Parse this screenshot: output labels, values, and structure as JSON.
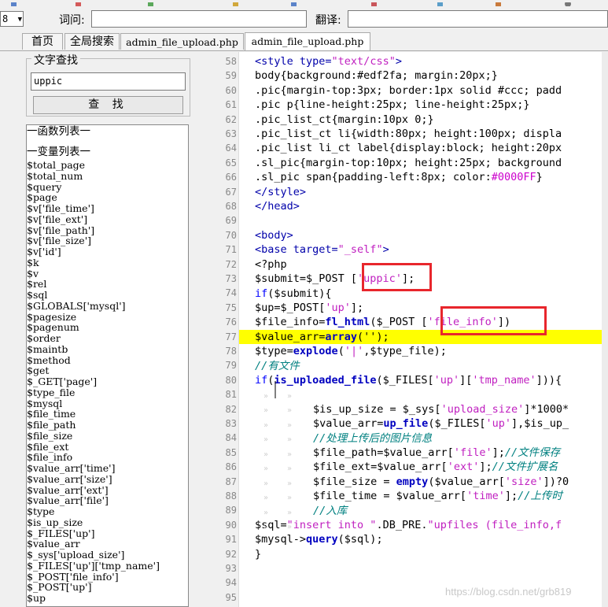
{
  "toolbar": {
    "select_value": "8",
    "word_label": "词问:",
    "translate_label": "翻译:"
  },
  "tabs": [
    {
      "label": "首页"
    },
    {
      "label": "全局搜索"
    },
    {
      "label": "admin_file_upload.php"
    },
    {
      "label": "admin_file_upload.php"
    }
  ],
  "search_panel": {
    "title": "文字查找",
    "input_value": "uppic",
    "find_button": "查 找"
  },
  "list": {
    "function_header": "一函数列表一",
    "variable_header": "一变量列表一",
    "variables": [
      "$total_page",
      "$total_num",
      "$query",
      "$page",
      "$v['file_time']",
      "$v['file_ext']",
      "$v['file_path']",
      "$v['file_size']",
      "$v['id']",
      "$k",
      "$v",
      "$rel",
      "$sql",
      "$GLOBALS['mysql']",
      "$pagesize",
      "$pagenum",
      "$order",
      "$maintb",
      "$method",
      "$get",
      "$_GET['page']",
      "$type_file",
      "$mysql",
      "$file_time",
      "$file_path",
      "$file_size",
      "$file_ext",
      "$file_info",
      "$value_arr['time']",
      "$value_arr['size']",
      "$value_arr['ext']",
      "$value_arr['file']",
      "$type",
      "$is_up_size",
      "$_FILES['up']",
      "$value_arr",
      "$_sys['upload_size']",
      "$_FILES['up']['tmp_name']",
      "$_POST['file_info']",
      "$_POST['up']",
      "$up"
    ]
  },
  "editor": {
    "line_numbers": [
      "58",
      "59",
      "60",
      "61",
      "62",
      "63",
      "64",
      "65",
      "66",
      "67",
      "68",
      "69",
      "70",
      "71",
      "72",
      "73",
      "74",
      "75",
      "76",
      "77",
      "78",
      "79",
      "80",
      "81",
      "82",
      "83",
      "84",
      "85",
      "86",
      "87",
      "88",
      "89",
      "90",
      "91",
      "92",
      "93",
      "94",
      "95"
    ],
    "highlighted_line": "77",
    "code": {
      "l58a": "<style type=",
      "l58b": "\"text/css\"",
      "l58c": ">",
      "l59": "body{background:#edf2fa; margin:20px;}",
      "l60": ".pic{margin-top:3px; border:1px solid #ccc; padd",
      "l61": ".pic p{line-height:25px; line-height:25px;}",
      "l62": ".pic_list_ct{margin:10px 0;}",
      "l63": ".pic_list_ct li{width:80px; height:100px; displa",
      "l64": ".pic_list li_ct label{display:block; height:20px",
      "l65": ".sl_pic{margin-top:10px; height:25px; background",
      "l66a": ".sl_pic span{padding-left:8px; color:",
      "l66b": "#0000FF",
      "l66c": "}",
      "l67": "</style>",
      "l68": "</head>",
      "l69": "",
      "l70": "<body>",
      "l71a": "<base target=",
      "l71b": "\"_self\"",
      "l71c": ">",
      "l72": "<?php",
      "l73a": "$submit=$_POST [",
      "l73b": "'uppic'",
      "l73c": "];",
      "l74a": "if",
      "l74b": "($submit){",
      "l75a": "$up=$_POST[",
      "l75b": "'up'",
      "l75c": "];",
      "l76a": "$file_info=",
      "l76b": "fl_html",
      "l76c": "($_POST [",
      "l76d": "'file_info'",
      "l76e": "])",
      "l77a": "$value_arr=",
      "l77b": "array",
      "l77c": "('');",
      "l78a": "$type=",
      "l78b": "explode",
      "l78c": "(",
      "l78d": "'|'",
      "l78e": ",$type_file);",
      "l79": "//有文件",
      "l80a": "if",
      "l80b": "(",
      "l80c": "is_uploaded_file",
      "l80d": "($_FILES[",
      "l80e": "'up'",
      "l80f": "][",
      "l80g": "'tmp_name'",
      "l80h": "])){",
      "l81": "",
      "l82a": "$is_up_size = $_sys[",
      "l82b": "'upload_size'",
      "l82c": "]*1000*",
      "l83a": "$value_arr=",
      "l83b": "up_file",
      "l83c": "($_FILES[",
      "l83d": "'up'",
      "l83e": "],$is_up_",
      "l84": "//处理上传后的图片信息",
      "l85a": "$file_path=$value_arr[",
      "l85b": "'file'",
      "l85c": "];",
      "l85d": "//文件保存",
      "l86a": "$file_ext=$value_arr[",
      "l86b": "'ext'",
      "l86c": "];",
      "l86d": "//文件扩展名",
      "l87a": "$file_size = ",
      "l87b": "empty",
      "l87c": "($value_arr[",
      "l87d": "'size'",
      "l87e": "])?0",
      "l88a": "$file_time = $value_arr[",
      "l88b": "'time'",
      "l88c": "];",
      "l88d": "//上传时",
      "l89": "//入库",
      "l90a": "$sql=",
      "l90b": "\"insert into \"",
      "l90c": ".DB_PRE.",
      "l90d": "\"upfiles (file_info,f",
      "l91a": "$mysql->",
      "l91b": "query",
      "l91c": "($sql);",
      "l92": "}"
    }
  },
  "watermark": "https://blog.csdn.net/grb819"
}
